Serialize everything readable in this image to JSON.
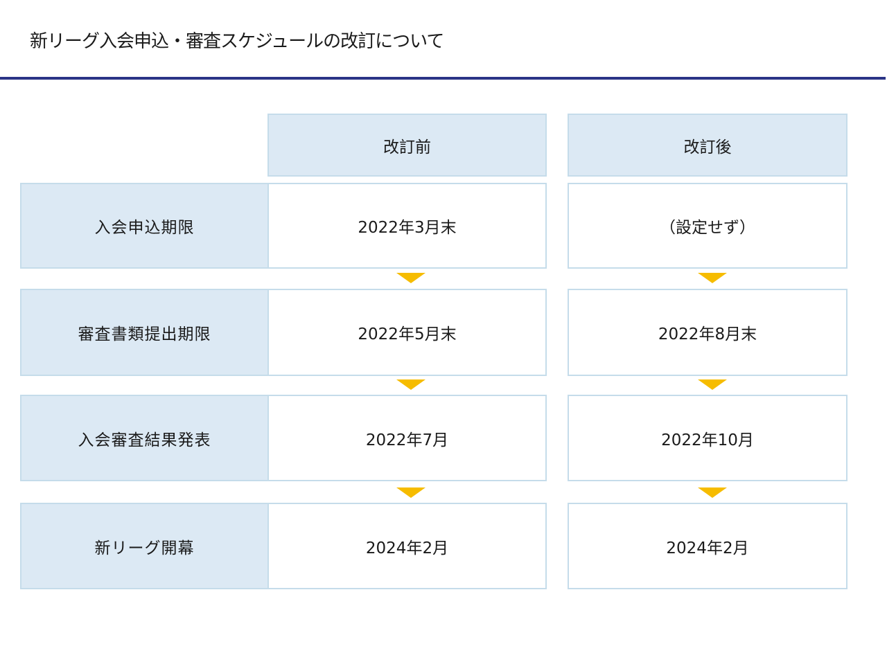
{
  "title": "新リーグ入会申込・審査スケジュールの改訂について",
  "colors": {
    "rule": "#2b3486",
    "cell_fill": "#dce9f4",
    "cell_border": "#c5dcea",
    "arrow": "#f6bc00"
  },
  "headers": {
    "before": "改訂前",
    "after": "改訂後"
  },
  "rows": [
    {
      "label": "入会申込期限",
      "before": "2022年3月末",
      "after": "（設定せず）"
    },
    {
      "label": "審査書類提出期限",
      "before": "2022年5月末",
      "after": "2022年8月末"
    },
    {
      "label": "入会審査結果発表",
      "before": "2022年7月",
      "after": "2022年10月"
    },
    {
      "label": "新リーグ開幕",
      "before": "2024年2月",
      "after": "2024年2月"
    }
  ],
  "icons": {
    "flow_arrow": "down-triangle-icon"
  }
}
